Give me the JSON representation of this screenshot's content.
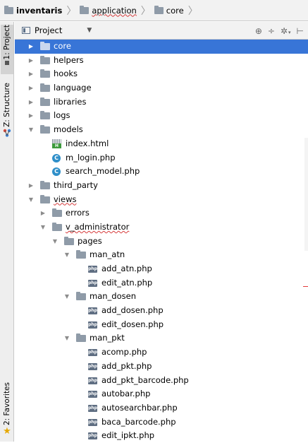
{
  "breadcrumb": [
    "inventaris",
    "application",
    "core"
  ],
  "tool_tabs": {
    "project": "1: Project",
    "structure": "Z: Structure",
    "favorites": "2: Favorites"
  },
  "panel": {
    "title": "Project",
    "view_dropdown_icon": "chevron-down-icon",
    "tools": [
      "target-icon",
      "collapse-icon",
      "gear-icon",
      "hide-icon"
    ]
  },
  "tree": [
    {
      "label": "core",
      "type": "folder",
      "depth": 0,
      "expanded": false,
      "selected": true
    },
    {
      "label": "helpers",
      "type": "folder",
      "depth": 0,
      "expanded": false
    },
    {
      "label": "hooks",
      "type": "folder",
      "depth": 0,
      "expanded": false
    },
    {
      "label": "language",
      "type": "folder",
      "depth": 0,
      "expanded": false
    },
    {
      "label": "libraries",
      "type": "folder",
      "depth": 0,
      "expanded": false
    },
    {
      "label": "logs",
      "type": "folder",
      "depth": 0,
      "expanded": false
    },
    {
      "label": "models",
      "type": "folder",
      "depth": 0,
      "expanded": true
    },
    {
      "label": "index.html",
      "type": "html",
      "depth": 1
    },
    {
      "label": "m_login.php",
      "type": "class",
      "depth": 1
    },
    {
      "label": "search_model.php",
      "type": "class",
      "depth": 1
    },
    {
      "label": "third_party",
      "type": "folder",
      "depth": 0,
      "expanded": false
    },
    {
      "label": "views",
      "type": "folder",
      "depth": 0,
      "expanded": true,
      "squiggle": true
    },
    {
      "label": "errors",
      "type": "folder",
      "depth": 1,
      "expanded": false
    },
    {
      "label": "v_administrator",
      "type": "folder",
      "depth": 1,
      "expanded": true,
      "squiggle": true
    },
    {
      "label": "pages",
      "type": "folder",
      "depth": 2,
      "expanded": true
    },
    {
      "label": "man_atn",
      "type": "folder",
      "depth": 3,
      "expanded": true
    },
    {
      "label": "add_atn.php",
      "type": "php",
      "depth": 4
    },
    {
      "label": "edit_atn.php",
      "type": "php",
      "depth": 4
    },
    {
      "label": "man_dosen",
      "type": "folder",
      "depth": 3,
      "expanded": true
    },
    {
      "label": "add_dosen.php",
      "type": "php",
      "depth": 4
    },
    {
      "label": "edit_dosen.php",
      "type": "php",
      "depth": 4
    },
    {
      "label": "man_pkt",
      "type": "folder",
      "depth": 3,
      "expanded": true
    },
    {
      "label": "acomp.php",
      "type": "php",
      "depth": 4
    },
    {
      "label": "add_pkt.php",
      "type": "php",
      "depth": 4
    },
    {
      "label": "add_pkt_barcode.php",
      "type": "php",
      "depth": 4
    },
    {
      "label": "autobar.php",
      "type": "php",
      "depth": 4
    },
    {
      "label": "autosearchbar.php",
      "type": "php",
      "depth": 4
    },
    {
      "label": "baca_barcode.php",
      "type": "php",
      "depth": 4
    },
    {
      "label": "edit_ipkt.php",
      "type": "php",
      "depth": 4
    }
  ],
  "colors": {
    "selection": "#3875d7",
    "folder": "#8f9ba8",
    "class_icon": "#2f8fc9",
    "php_icon": "#5f6e82"
  }
}
